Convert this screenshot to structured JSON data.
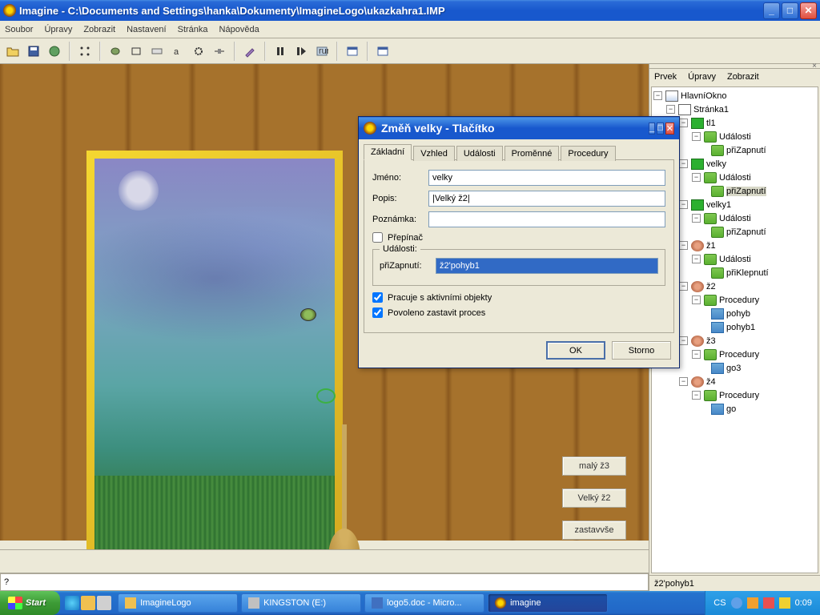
{
  "titlebar": {
    "text": "Imagine - C:\\Documents and Settings\\hanka\\Dokumenty\\ImagineLogo\\ukazkahra1.IMP"
  },
  "menu": {
    "items": [
      "Soubor",
      "Úpravy",
      "Zobrazit",
      "Nastavení",
      "Stránka",
      "Nápověda"
    ]
  },
  "scene_buttons": {
    "b1": "malý ž3",
    "b2": "Velký ž2",
    "b3": "zastavvše"
  },
  "cmd_prompt": "?",
  "tree": {
    "menu": [
      "Prvek",
      "Úpravy",
      "Zobrazit"
    ],
    "root": "HlavníOkno",
    "page": "Stránka1",
    "n_tl1": "tl1",
    "n_udalosti": "Události",
    "n_prizap": "přiZapnutí",
    "n_velky": "velky",
    "n_velky1": "velky1",
    "n_z1": "ž1",
    "n_priklep": "přiKlepnutí",
    "n_z2": "ž2",
    "n_procedury": "Procedury",
    "n_pohyb": "pohyb",
    "n_pohyb1": "pohyb1",
    "n_z3": "ž3",
    "n_go3": "go3",
    "n_z4": "ž4",
    "n_go": "go",
    "status": "ž2'pohyb1"
  },
  "dialog": {
    "title": "Změň velky  - Tlačítko",
    "tabs": [
      "Základní",
      "Vzhled",
      "Události",
      "Proměnné",
      "Procedury"
    ],
    "lbl_jmeno": "Jméno:",
    "val_jmeno": "velky",
    "lbl_popis": "Popis:",
    "val_popis": "|Velký ž2|",
    "lbl_pozn": "Poznámka:",
    "val_pozn": "",
    "chk_prepinac": "Přepínač",
    "legend_udalosti": "Události:",
    "lbl_prizap": "přiZapnutí:",
    "val_prizap": "ž2'pohyb1",
    "chk_aktiv": "Pracuje s aktivními objekty",
    "chk_proces": "Povoleno zastavit proces",
    "btn_ok": "OK",
    "btn_storno": "Storno"
  },
  "taskbar": {
    "start": "Start",
    "items": [
      "ImagineLogo",
      "KINGSTON (E:)",
      "logo5.doc - Micro...",
      "imagine"
    ],
    "lang": "CS",
    "clock": "0:09"
  }
}
